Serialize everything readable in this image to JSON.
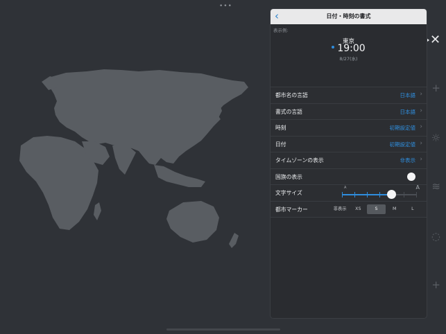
{
  "panel": {
    "title": "日付・時刻の書式",
    "preview_label": "表示例:",
    "preview_city": "東京",
    "preview_time": "19:00",
    "preview_date": "8/27(水)"
  },
  "rows": [
    {
      "label": "都市名の言語",
      "value": "日本語"
    },
    {
      "label": "書式の言語",
      "value": "日本語"
    },
    {
      "label": "時刻",
      "value": "初期設定値"
    },
    {
      "label": "日付",
      "value": "初期設定値"
    },
    {
      "label": "タイムゾーンの表示",
      "value": "非表示"
    }
  ],
  "flag_row": {
    "label": "国旗の表示",
    "toggle_on": false
  },
  "font_size": {
    "label": "文字サイズ",
    "small_a": "A",
    "large_a": "A",
    "steps": 7,
    "selected_step": 4
  },
  "marker": {
    "label": "都市マーカー",
    "options": [
      "非表示",
      "XS",
      "S",
      "M",
      "L"
    ],
    "selected": "S"
  },
  "colors": {
    "accent": "#2f8ede",
    "background": "#2f3237",
    "land": "#595d62"
  },
  "icons": [
    "chevron-left-icon",
    "play-icon",
    "close-icon",
    "plus-icon",
    "sun-icon",
    "wave-icon",
    "chat-icon"
  ]
}
